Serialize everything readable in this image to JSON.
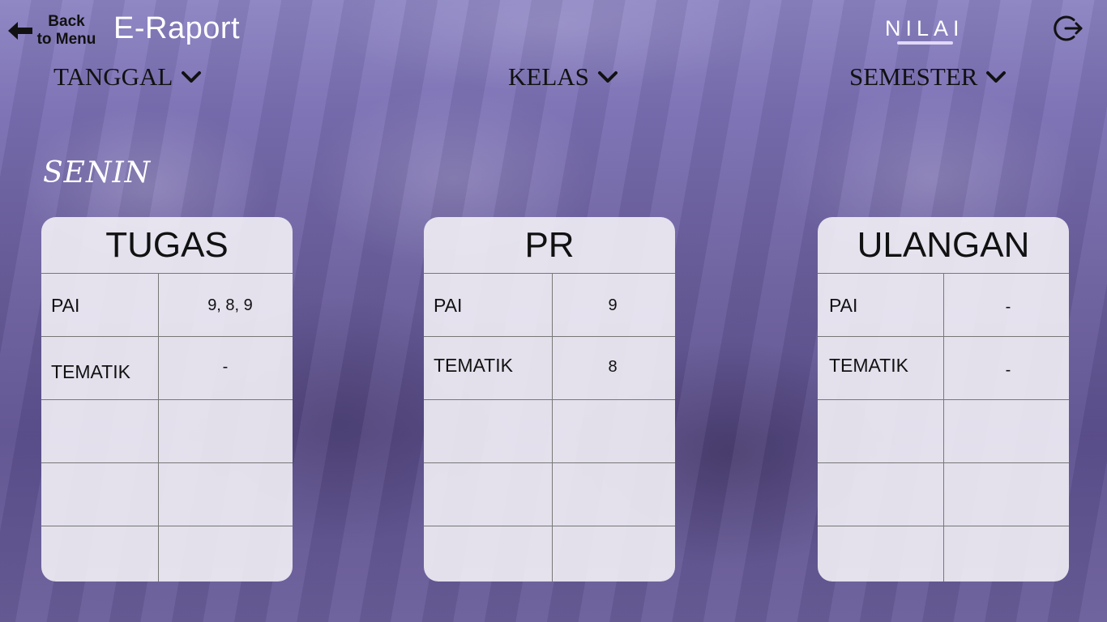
{
  "header": {
    "back_label": "Back\nto Menu",
    "app_title": "E-Raport",
    "nav_active": "NILAI"
  },
  "filters": {
    "tanggal": "TANGGAL",
    "kelas": "KELAS",
    "semester": "SEMESTER"
  },
  "day": "SENIN",
  "cards": [
    {
      "title": "TUGAS",
      "rows": [
        {
          "subject": "PAI",
          "value": "9, 8, 9"
        },
        {
          "subject": "TEMATIK",
          "value": "-"
        },
        {
          "subject": "",
          "value": ""
        },
        {
          "subject": "",
          "value": ""
        },
        {
          "subject": "",
          "value": ""
        }
      ]
    },
    {
      "title": "PR",
      "rows": [
        {
          "subject": "PAI",
          "value": "9"
        },
        {
          "subject": "TEMATIK",
          "value": "8"
        },
        {
          "subject": "",
          "value": ""
        },
        {
          "subject": "",
          "value": ""
        },
        {
          "subject": "",
          "value": ""
        }
      ]
    },
    {
      "title": "ULANGAN",
      "rows": [
        {
          "subject": "PAI",
          "value": "-"
        },
        {
          "subject": "TEMATIK",
          "value": "-"
        },
        {
          "subject": "",
          "value": ""
        },
        {
          "subject": "",
          "value": ""
        },
        {
          "subject": "",
          "value": ""
        }
      ]
    }
  ],
  "colors": {
    "overlay": "#7a6fb3",
    "card_bg": "#f2f0f6",
    "accent_underline": "#e0d8f7"
  }
}
